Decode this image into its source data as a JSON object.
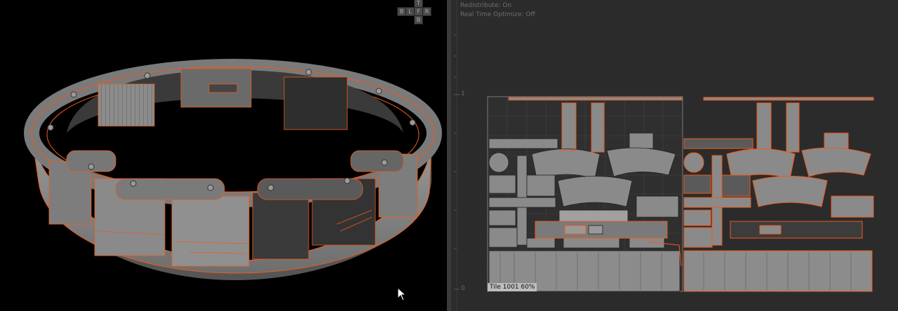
{
  "navcube": {
    "top": "T",
    "left": "B",
    "l": "L",
    "front": "F",
    "right": "R",
    "bottom": "B"
  },
  "uv_editor": {
    "redistribute": "Redistribute: On",
    "realtime": "Real Time Optimize: Off",
    "axis_one": "1",
    "axis_zero": "0",
    "tile_label": "Tile 1001 60%"
  },
  "colors": {
    "accent": "#f05a1a",
    "mesh": "#8a8a8a",
    "mesh_dark": "#4a4a4a",
    "bg": "#2b2b2b"
  },
  "cursor": "mouse-pointer-icon"
}
